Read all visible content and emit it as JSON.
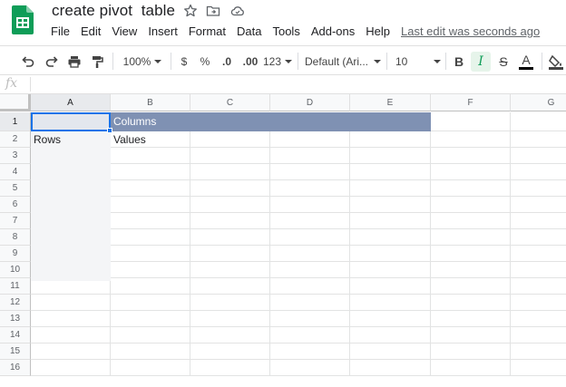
{
  "title": {
    "doc_name": "create pivot  table",
    "last_edit": "Last edit was seconds ago"
  },
  "menu": [
    "File",
    "Edit",
    "View",
    "Insert",
    "Format",
    "Data",
    "Tools",
    "Add-ons",
    "Help"
  ],
  "toolbar": {
    "zoom": "100%",
    "currency": "$",
    "percent": "%",
    "decrease_decimals": ".0",
    "increase_decimals": ".00",
    "more_formats": "123",
    "font": "Default (Ari...",
    "font_size": "10",
    "bold": "B",
    "italic": "I",
    "strike": "S",
    "text_color": "A"
  },
  "formula_bar": {
    "fx": "fx",
    "value": ""
  },
  "grid": {
    "columns": [
      "A",
      "B",
      "C",
      "D",
      "E",
      "F",
      "G"
    ],
    "rows": [
      "1",
      "2",
      "3",
      "4",
      "5",
      "6",
      "7",
      "8",
      "9",
      "10",
      "11",
      "12",
      "13",
      "14",
      "15",
      "16"
    ],
    "cells": {
      "B1": "Columns",
      "A2": "Rows",
      "B2": "Values"
    }
  },
  "colors": {
    "header_band": "#7f91b3",
    "selection": "#1a73e8",
    "sheets_green": "#0f9d58"
  }
}
